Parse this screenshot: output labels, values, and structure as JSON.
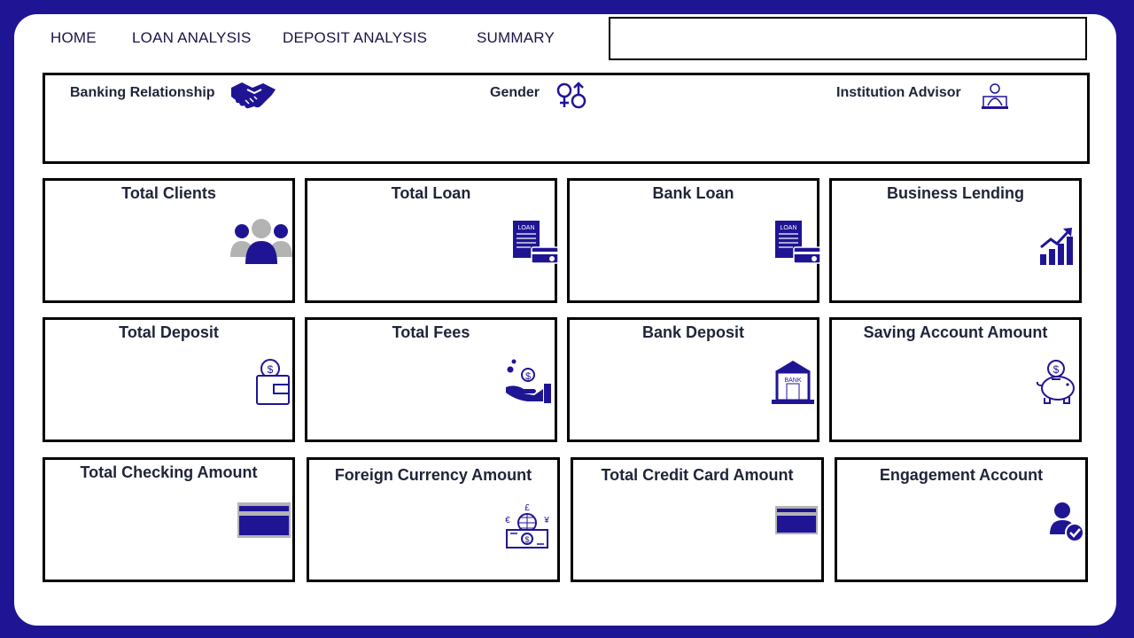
{
  "nav": {
    "home": "HOME",
    "loan_analysis": "LOAN ANALYSIS",
    "deposit_analysis": "DEPOSIT ANALYSIS",
    "summary": "SUMMARY"
  },
  "search": {
    "value": ""
  },
  "filters": {
    "banking_relationship": "Banking Relationship",
    "gender": "Gender",
    "institution_advisor": "Institution Advisor"
  },
  "cards": {
    "total_clients": "Total Clients",
    "total_loan": "Total Loan",
    "bank_loan": "Bank Loan",
    "business_lending": "Business Lending",
    "total_deposit": "Total Deposit",
    "total_fees": "Total  Fees",
    "bank_deposit": "Bank Deposit",
    "saving_account_amount": "Saving Account Amount",
    "total_checking_amount": "Total Checking Amount",
    "foreign_currency_amount": "Foreign Currency Amount",
    "total_credit_card_amount": "Total Credit Card Amount",
    "engagement_account": "Engagement Account"
  },
  "icon_text": {
    "loan_doc": "LOAN",
    "bank_building": "BANK"
  },
  "colors": {
    "accent": "#1f1594",
    "panel": "#ffffff",
    "border": "#000000",
    "icon_gray": "#b3b3b3"
  },
  "icons": {
    "banking_relationship": "handshake-icon",
    "gender": "gender-icon",
    "institution_advisor": "advisor-icon",
    "total_clients": "users-group-icon",
    "total_loan": "loan-document-icon",
    "bank_loan": "loan-document-icon",
    "business_lending": "growth-chart-icon",
    "total_deposit": "wallet-coin-icon",
    "total_fees": "hand-coins-icon",
    "bank_deposit": "bank-building-icon",
    "saving_account_amount": "piggy-bank-icon",
    "total_checking_amount": "credit-card-icon",
    "foreign_currency_amount": "currency-exchange-icon",
    "total_credit_card_amount": "credit-card-icon",
    "engagement_account": "user-check-icon"
  }
}
